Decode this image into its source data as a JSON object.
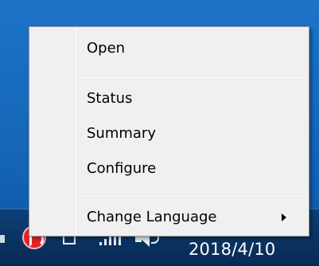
{
  "menu": {
    "items": [
      {
        "label": "Open"
      },
      {
        "label": "Status"
      },
      {
        "label": "Summary"
      },
      {
        "label": "Configure"
      },
      {
        "label": "Change Language",
        "has_submenu": true
      }
    ]
  },
  "taskbar": {
    "tray_icons": [
      "show-hidden-icons-icon",
      "app-tray-icon",
      "network-icon",
      "signal-icon",
      "volume-icon"
    ],
    "clock": {
      "date": "2018/4/10"
    }
  },
  "colors": {
    "desktop": "#1566b8",
    "taskbar": "#0b3566",
    "menu_bg": "#f0f0f0",
    "app_icon": "#e5222b"
  }
}
